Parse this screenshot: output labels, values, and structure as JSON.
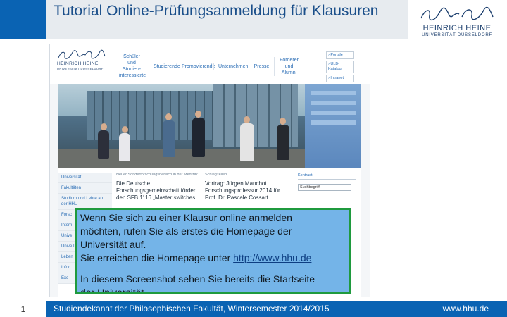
{
  "slide": {
    "title": "Tutorial Online-Prüfungsanmeldung für Klausuren",
    "page_number": "1"
  },
  "logo": {
    "name": "HEINRICH HEINE",
    "sub": "UNIVERSITÄT DÜSSELDORF"
  },
  "website": {
    "logo_name": "HEINRICH HEINE",
    "logo_sub": "UNIVERSITÄT DÜSSELDORF",
    "nav": [
      {
        "label": "Schüler und Studien-interessierte"
      },
      {
        "label": "Studierende"
      },
      {
        "label": "Promovierende"
      },
      {
        "label": "Unternehmen"
      },
      {
        "label": "Presse"
      },
      {
        "label": "Förderer und Alumni"
      }
    ],
    "quick_links": [
      "› Portale",
      "› ULB-Katalog",
      "› Intranet"
    ],
    "sidebar": [
      "Universität",
      "Fakultäten",
      "Studium und Lehre an der HHU",
      "Forsc",
      "Intern",
      "Unive",
      "Unive Lande",
      "Leben",
      "Infoc",
      "Exc"
    ],
    "news_kicker": "Neuer Sonderforschungsbereich in der Medizin:",
    "news_headline": "Die Deutsche Forschungsgemeinschaft fördert den SFB 1116 „Master switches",
    "headlines_label": "Schlagzeilen",
    "headlines_text": "Vortrag: Jürgen Manchot Forschungsprofessur 2014 für Prof. Dr. Pascale Cossart",
    "contact_label": "Kontrast",
    "search_value": "Suchbegriff"
  },
  "callout": {
    "line1": "Wenn Sie sich zu einer Klausur online anmelden",
    "line2": "möchten, rufen Sie als erstes die Homepage der",
    "line3": "Universität auf.",
    "line4_prefix": "Sie erreichen die Homepage unter ",
    "link": "http://www.hhu.de",
    "line5": "In diesem Screenshot sehen Sie bereits die Startseite",
    "line6": "der Universität."
  },
  "footer": {
    "left": "Studiendekanat der Philosophischen Fakultät, Wintersemester 2014/2015",
    "right": "www.hhu.de"
  },
  "colors": {
    "accent_blue": "#0a63b3",
    "callout_fill": "#74b4e8",
    "callout_border": "#1f9a3e",
    "title_text": "#1b4f8a"
  }
}
